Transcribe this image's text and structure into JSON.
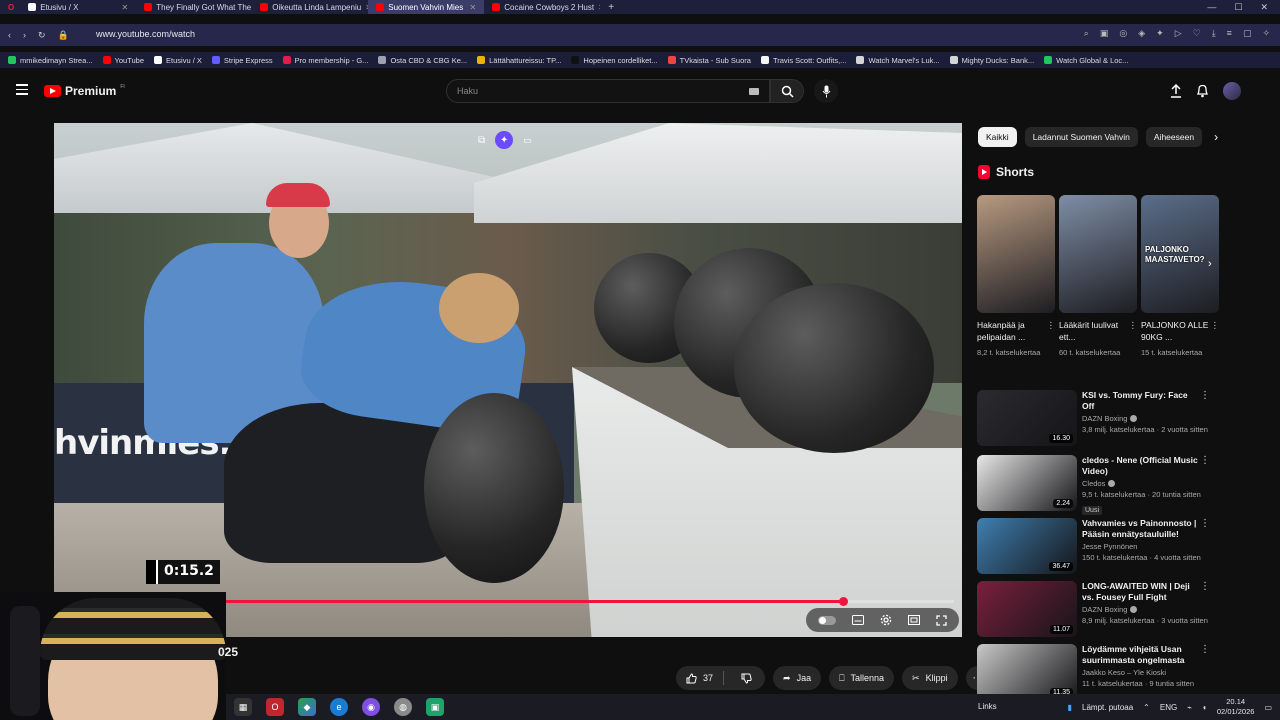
{
  "browser": {
    "tabs": [
      {
        "title": "Etusivu / X",
        "color": "#ffffff",
        "active": false
      },
      {
        "title": "They Finally Got What The",
        "color": "#ff0000",
        "active": false
      },
      {
        "title": "Oikeutta Linda Lampeniu",
        "color": "#ff0000",
        "active": false
      },
      {
        "title": "Suomen Vahvin Mies",
        "color": "#ff0000",
        "active": true
      },
      {
        "title": "Cocaine Cowboys 2 Hust",
        "color": "#ff0000",
        "active": false
      }
    ],
    "new_tab": "+",
    "url": "www.youtube.com/watch",
    "bookmarks": [
      {
        "label": "mmikedimayn Strea...",
        "color": "#22c55e"
      },
      {
        "label": "YouTube",
        "color": "#ff0000"
      },
      {
        "label": "Etusivu / X",
        "color": "#ffffff"
      },
      {
        "label": "Stripe Express",
        "color": "#635bff"
      },
      {
        "label": "Pro membership - G...",
        "color": "#e11d48"
      },
      {
        "label": "Osta CBD & CBG Ke...",
        "color": "#9ca3af"
      },
      {
        "label": "Lättähattureissu: TP...",
        "color": "#eab308"
      },
      {
        "label": "Hopeinen cordelliket...",
        "color": "#111111"
      },
      {
        "label": "TVkaista - Sub Suora",
        "color": "#ef4444"
      },
      {
        "label": "Travis Scott: Outfits,...",
        "color": "#f5f5f5"
      },
      {
        "label": "Watch Marvel's Luk...",
        "color": "#d4d4d4"
      },
      {
        "label": "Mighty Ducks: Bank...",
        "color": "#d4d4d4"
      },
      {
        "label": "Watch Global & Loc...",
        "color": "#22c55e"
      }
    ]
  },
  "yt": {
    "logo_text": "Premium",
    "logo_sup": "FI",
    "search_placeholder": "Haku"
  },
  "player": {
    "timer": "0:15.2",
    "progress": 0.876
  },
  "below": {
    "year_fragment": "025",
    "likes": "37",
    "share": "Jaa",
    "save": "Tallenna",
    "clip": "Klippi",
    "more": "⋯"
  },
  "sidebar": {
    "chips": [
      "Kaikki",
      "Ladannut Suomen Vahvin",
      "Aiheeseen"
    ],
    "shorts_heading": "Shorts",
    "shorts": [
      {
        "title": "Hakanpää ja pelipaidan ...",
        "views": "8,2 t. katselukertaa",
        "bg": "#b89a80",
        "overlay": ""
      },
      {
        "title": "Lääkärit luulivat ett...",
        "views": "60 t. katselukertaa",
        "bg": "#7e8ea6",
        "overlay": ""
      },
      {
        "title": "PALJONKO ALLE 90KG ...",
        "views": "15 t. katselukertaa",
        "bg": "#5b6e8a",
        "overlay": "PALJONKO MAASTAVETO?"
      }
    ],
    "recs": [
      {
        "title": "KSI vs. Tommy Fury: Face Off",
        "channel": "DAZN Boxing",
        "meta": "3,8 milj. katselukertaa · 2 vuotta sitten",
        "duration": "16.30",
        "badge": "",
        "bg": "#2a2a30",
        "verified": true
      },
      {
        "title": "cledos - Nene (Official Music Video)",
        "channel": "Cledos",
        "meta": "9,5 t. katselukertaa · 20 tuntia sitten",
        "duration": "2.24",
        "badge": "Uusi",
        "bg": "#e8e8e8",
        "verified": true
      },
      {
        "title": "Vahvamies vs Painonnosto | Pääsin ennätystauluille!",
        "channel": "Jesse Pynnönen",
        "meta": "150 t. katselukertaa · 4 vuotta sitten",
        "duration": "36.47",
        "badge": "",
        "bg": "#3f7fb0",
        "verified": false
      },
      {
        "title": "LONG-AWAITED WIN | Deji vs. Fousey Full Fight",
        "channel": "DAZN Boxing",
        "meta": "8,9 milj. katselukertaa · 3 vuotta sitten",
        "duration": "11.07",
        "badge": "",
        "bg": "#7a1f3d",
        "verified": true
      },
      {
        "title": "Löydämme vihjeitä Usan suurimmasta ongelmasta",
        "channel": "Jaakko Keso – Yle Kioski",
        "meta": "11 t. katselukertaa · 9 tuntia sitten",
        "duration": "11.35",
        "badge": "",
        "bg": "#c9c9c9",
        "verified": false
      }
    ]
  },
  "taskbar": {
    "links": "Links",
    "weather": "Lämpt. putoaa",
    "lang": "ENG",
    "time": "20.14",
    "date": "02/01/2026"
  }
}
